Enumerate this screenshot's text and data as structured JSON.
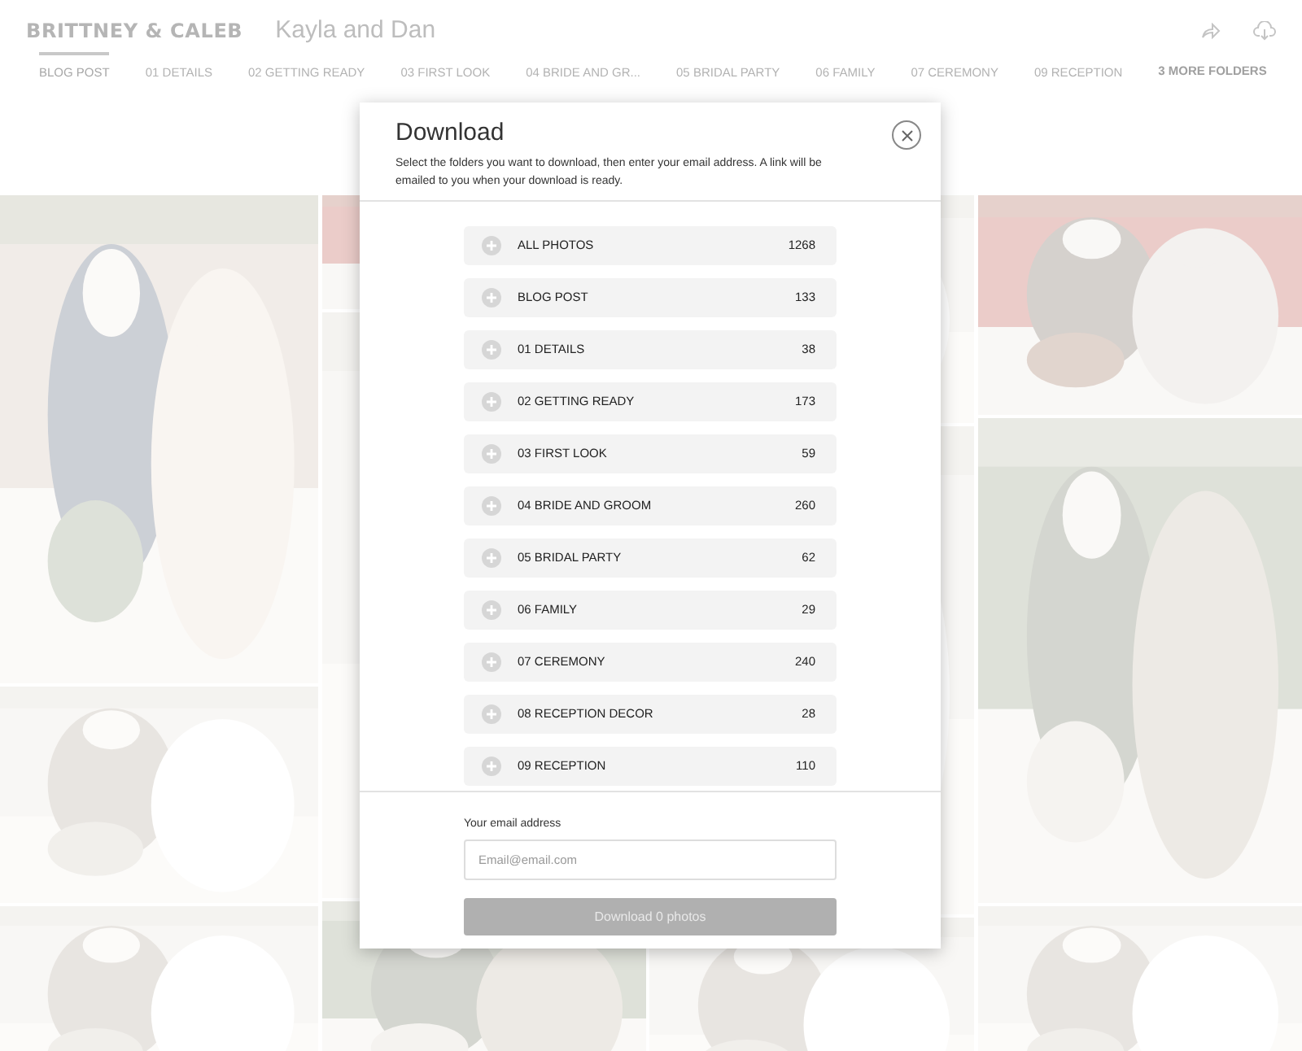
{
  "header": {
    "logo": "BRITTNEY & CALEB",
    "gallery_title": "Kayla and Dan"
  },
  "tabs": [
    {
      "label": "BLOG POST",
      "selected": true
    },
    {
      "label": "01 DETAILS",
      "selected": false
    },
    {
      "label": "02 GETTING READY",
      "selected": false
    },
    {
      "label": "03 FIRST LOOK",
      "selected": false
    },
    {
      "label": "04 BRIDE AND GR...",
      "selected": false
    },
    {
      "label": "05 BRIDAL PARTY",
      "selected": false
    },
    {
      "label": "06 FAMILY",
      "selected": false
    },
    {
      "label": "07 CEREMONY",
      "selected": false
    },
    {
      "label": "09 RECEPTION",
      "selected": false
    }
  ],
  "more_folders": "3 MORE FOLDERS",
  "dialog": {
    "title": "Download",
    "description": "Select the folders you want to download, then enter your email address. A link will be emailed to you when your download is ready.",
    "folders": [
      {
        "name": "ALL PHOTOS",
        "count": "1268"
      },
      {
        "name": "BLOG POST",
        "count": "133"
      },
      {
        "name": "01 DETAILS",
        "count": "38"
      },
      {
        "name": "02 GETTING READY",
        "count": "173"
      },
      {
        "name": "03 FIRST LOOK",
        "count": "59"
      },
      {
        "name": "04 BRIDE AND GROOM",
        "count": "260"
      },
      {
        "name": "05 BRIDAL PARTY",
        "count": "62"
      },
      {
        "name": "06 FAMILY",
        "count": "29"
      },
      {
        "name": "07 CEREMONY",
        "count": "240"
      },
      {
        "name": "08 RECEPTION DECOR",
        "count": "28"
      },
      {
        "name": "09 RECEPTION",
        "count": "110"
      }
    ],
    "email_label": "Your email address",
    "email_placeholder": "Email@email.com",
    "submit": "Download 0 photos"
  }
}
